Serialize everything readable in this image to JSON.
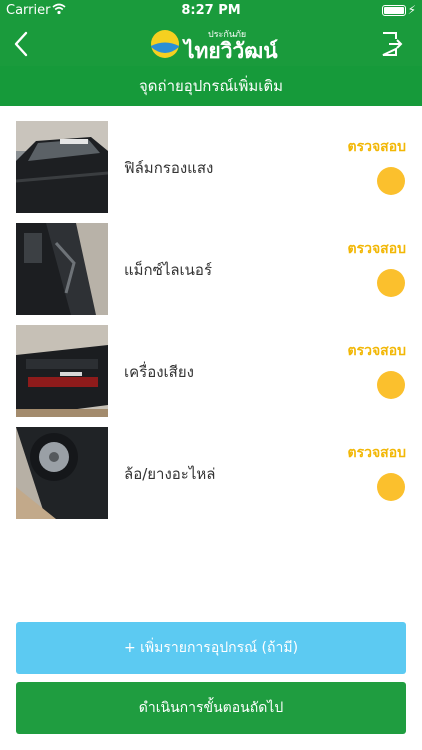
{
  "status_bar": {
    "carrier": "Carrier",
    "time": "8:27 PM"
  },
  "nav": {
    "logo_small": "ประกันภัย",
    "logo_big": "ไทยวิวัฒน์"
  },
  "header": {
    "title": "จุดถ่ายอุปกรณ์เพิ่มเติม"
  },
  "items": [
    {
      "label": "ฟิล์มกรองแสง",
      "action": "ตรวจสอบ"
    },
    {
      "label": "แม็กซ์ไลเนอร์",
      "action": "ตรวจสอบ"
    },
    {
      "label": "เครื่องเสียง",
      "action": "ตรวจสอบ"
    },
    {
      "label": "ล้อ/ยางอะไหล่",
      "action": "ตรวจสอบ"
    }
  ],
  "buttons": {
    "add": "+ เพิ่มรายการอุปกรณ์ (ถ้ามี)",
    "next": "ดำเนินการขั้นตอนถัดไป"
  },
  "colors": {
    "primary_green": "#1a9b3c",
    "accent_yellow": "#fbc02d",
    "add_button": "#5ccaf2"
  }
}
